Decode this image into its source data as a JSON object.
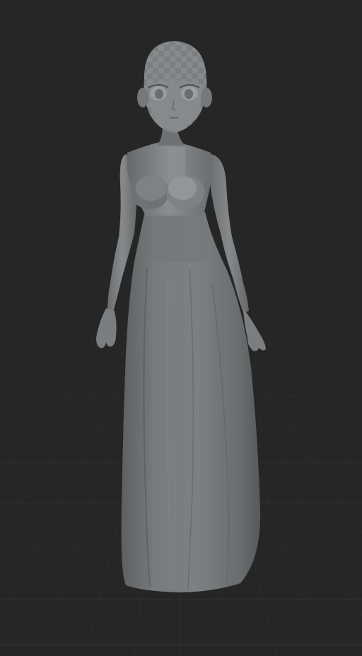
{
  "viewport": {
    "background_color": "#262626",
    "grid_color": "#3a3a3a",
    "model_base_color": "#7a7e7f",
    "model_shadow_color": "#5a5e60",
    "model_highlight_color": "#9a9ea0",
    "checker_light_color": "#8a8e90",
    "checker_dark_color": "#707476",
    "scene_object": "character-model-dress"
  }
}
